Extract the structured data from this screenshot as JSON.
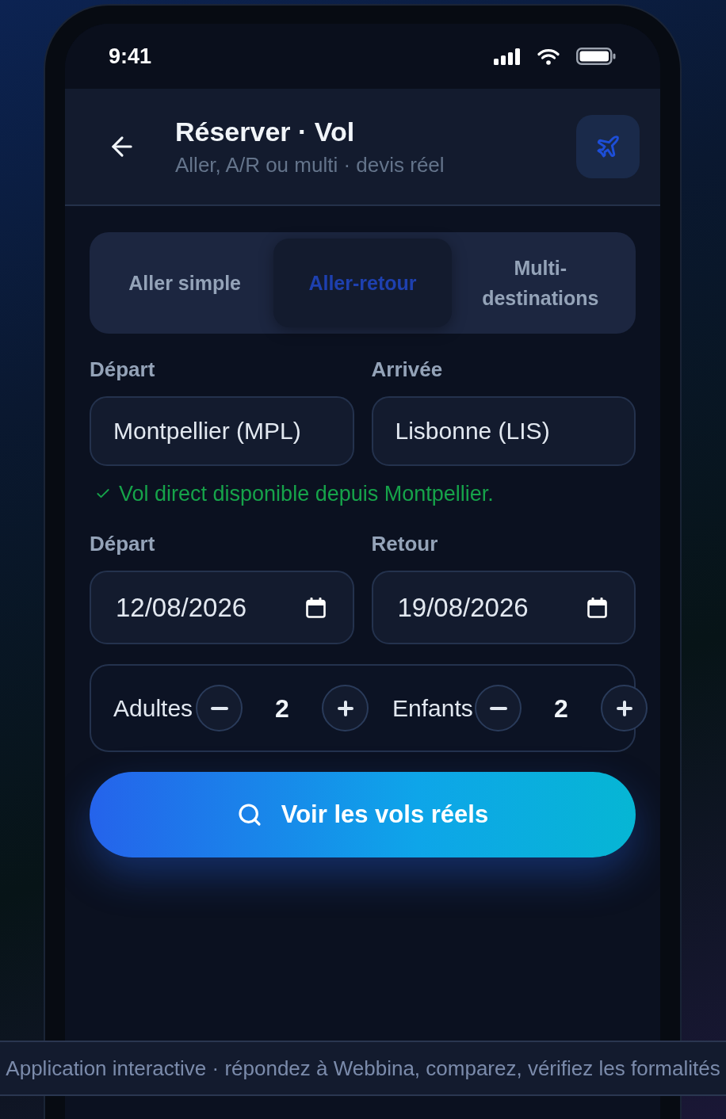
{
  "status_bar": {
    "time": "9:41"
  },
  "header": {
    "title": "Réserver · Vol",
    "subtitle": "Aller, A/R ou multi · devis réel"
  },
  "trip_type_tabs": [
    {
      "label": "Aller simple",
      "selected": false
    },
    {
      "label": "Aller-retour",
      "selected": true
    },
    {
      "label": "Multi-destinations",
      "selected": false
    }
  ],
  "route": {
    "fields": [
      {
        "label": "Départ",
        "value": "Montpellier (MPL)"
      },
      {
        "label": "Arrivée",
        "value": "Lisbonne (LIS)"
      }
    ],
    "notice": {
      "kind": "success",
      "text": "Vol direct disponible depuis Montpellier."
    }
  },
  "dates": [
    {
      "label": "Départ",
      "value": "12/08/2026"
    },
    {
      "label": "Retour",
      "value": "19/08/2026"
    }
  ],
  "passengers": [
    {
      "label": "Adultes",
      "count": "2"
    },
    {
      "label": "Enfants",
      "count": "2"
    }
  ],
  "search_button": {
    "label": "Voir les vols réels"
  },
  "footer_banner": {
    "text": "Application interactive · répondez à Webbina, comparez, vérifiez les formalités"
  }
}
